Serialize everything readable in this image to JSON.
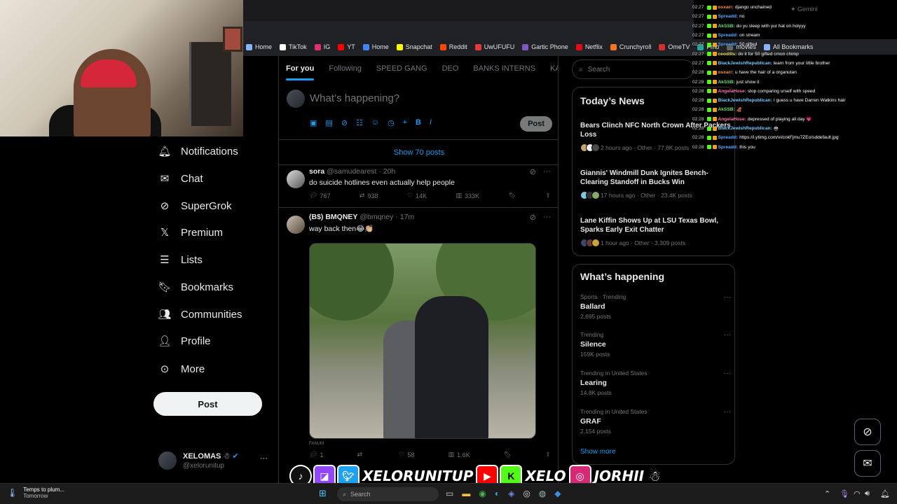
{
  "bookmarks": [
    {
      "label": "Home",
      "color": "#8ab4f8"
    },
    {
      "label": "TikTok",
      "color": "#ffffff"
    },
    {
      "label": "IG",
      "color": "#e1306c"
    },
    {
      "label": "YT",
      "color": "#ff0000"
    },
    {
      "label": "Home",
      "color": "#4285f4"
    },
    {
      "label": "Snapchat",
      "color": "#fffc00"
    },
    {
      "label": "Reddit",
      "color": "#ff4500"
    },
    {
      "label": "UwUFUFU",
      "color": "#e53935"
    },
    {
      "label": "Gartic Phone",
      "color": "#7e57c2"
    },
    {
      "label": "Netflix",
      "color": "#e50914"
    },
    {
      "label": "Crunchyroll",
      "color": "#f47521"
    },
    {
      "label": "OmeTV",
      "color": "#d32f2f"
    },
    {
      "label": "Fmo",
      "color": "#26a69a"
    },
    {
      "label": "movies",
      "color": "#666666"
    },
    {
      "label": "All Bookmarks",
      "color": "#8ab4f8"
    }
  ],
  "nav": {
    "items": [
      "Notifications",
      "Chat",
      "SuperGrok",
      "Premium",
      "Lists",
      "Bookmarks",
      "Communities",
      "Profile",
      "More"
    ],
    "post_label": "Post",
    "account_name": "XELOMAS",
    "account_handle": "@xelorunitup"
  },
  "timeline": {
    "tabs": [
      "For you",
      "Following",
      "SPEED GANG",
      "DEO",
      "BANKS INTERNS",
      "KAI MA"
    ],
    "compose_placeholder": "What’s happening?",
    "compose_post_label": "Post",
    "show_posts": "Show 70 posts",
    "tweets": [
      {
        "name": "sora",
        "handle": "@samudearest",
        "time": "· 20h",
        "text": "do suicide hotlines even actually help people",
        "replies": "767",
        "reposts": "938",
        "likes": "14K",
        "views": "333K"
      },
      {
        "name": "(B$) BMQNEY",
        "handle": "@bmqney",
        "time": "· 17m",
        "text": "way back then😂👏🏼",
        "image_caption": "FANUM",
        "replies": "1",
        "reposts": "",
        "likes": "58",
        "views": "1.6K"
      }
    ]
  },
  "right": {
    "search_placeholder": "Search",
    "news_title": "Today’s News",
    "news": [
      {
        "title": "Bears Clinch NFC North Crown After Packers Loss",
        "meta": "2 hours ago · Other · 77.8K posts"
      },
      {
        "title": "Giannis' Windmill Dunk Ignites Bench-Clearing Standoff in Bucks Win",
        "meta": "17 hours ago · Other · 23.4K posts"
      },
      {
        "title": "Lane Kiffin Shows Up at LSU Texas Bowl, Sparks Early Exit Chatter",
        "meta": "1 hour ago · Other · 3,309 posts"
      }
    ],
    "happening_title": "What’s happening",
    "trends": [
      {
        "context": "Sports · Trending",
        "name": "Ballard",
        "posts": "2,695 posts"
      },
      {
        "context": "Trending",
        "name": "Silence",
        "posts": "159K posts"
      },
      {
        "context": "Trending in United States",
        "name": "Learing",
        "posts": "14.8K posts"
      },
      {
        "context": "Trending in United States",
        "name": "GRAF",
        "posts": "2,154 posts"
      }
    ],
    "show_more": "Show more"
  },
  "chat": [
    {
      "ts": "02:27",
      "user": "osxarr:",
      "color": "#ff8c3a",
      "msg": "django unchained"
    },
    {
      "ts": "02:27",
      "user": "Spreadd:",
      "color": "#5aa9ff",
      "msg": "no"
    },
    {
      "ts": "02:27",
      "user": "AkSSB:",
      "color": "#6ee06e",
      "msg": "do yu sleep with yur hat on holyyy"
    },
    {
      "ts": "02:27",
      "user": "Spreadd:",
      "color": "#5aa9ff",
      "msg": "on stream"
    },
    {
      "ts": "02:27",
      "user": "Spreadd:",
      "color": "#5aa9ff",
      "msg": "50 gifted"
    },
    {
      "ts": "02:27",
      "user": "ceodills:",
      "color": "#f0e050",
      "msg": "do it for 50 gifted cmon chimp"
    },
    {
      "ts": "02:27",
      "user": "BlackJewishRepublican:",
      "color": "#6ecbff",
      "msg": "learn from your little brother"
    },
    {
      "ts": "02:28",
      "user": "osxarr:",
      "color": "#ff8c3a",
      "msg": "u have the hair of a organutan"
    },
    {
      "ts": "02:28",
      "user": "AkSSB:",
      "color": "#6ee06e",
      "msg": "just show it"
    },
    {
      "ts": "02:28",
      "user": "AngelaHose:",
      "color": "#ff6fb0",
      "msg": "stop comparing urself with speed"
    },
    {
      "ts": "02:28",
      "user": "BlackJewishRepublican:",
      "color": "#6ecbff",
      "msg": "I guess u have Darren Watkins hair"
    },
    {
      "ts": "02:28",
      "user": "AkSSB:",
      "color": "#6ee06e",
      "msg": "🦧"
    },
    {
      "ts": "02:28",
      "user": "AngelaHose:",
      "color": "#ff6fb0",
      "msg": "depressed of playing all day 💗"
    },
    {
      "ts": "02:28",
      "user": "BlackJewishRepublican:",
      "color": "#6ecbff",
      "msg": "😳"
    },
    {
      "ts": "02:28",
      "user": "Spreadd:",
      "color": "#5aa9ff",
      "msg": "https://i.ytimg.com/vi/cnkFjmu7ZEo/sddefault.jpg"
    },
    {
      "ts": "02:28",
      "user": "Spreadd:",
      "color": "#5aa9ff",
      "msg": "this you"
    }
  ],
  "gemini_label": "Gemini",
  "banner": {
    "name1": "XELORUNITUP",
    "name2": "XELO",
    "name3": "JORHII"
  },
  "taskbar": {
    "weather_title": "Temps to plum...",
    "weather_sub": "Tomorrow",
    "search_placeholder": "Search"
  }
}
